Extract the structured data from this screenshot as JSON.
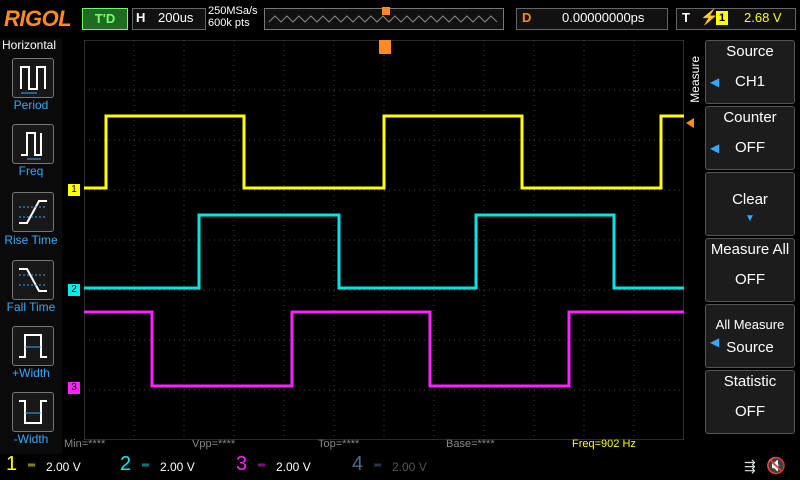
{
  "brand": "RIGOL",
  "trigger_status": "T'D",
  "timebase": {
    "label": "H",
    "value": "200us"
  },
  "sample_rate": "250MSa/s",
  "memory_depth": "600k pts",
  "delay": {
    "label": "D",
    "value": "0.00000000ps"
  },
  "trigger": {
    "label": "T",
    "edge": "rising-edge-icon",
    "source": "1",
    "level": "2.68 V"
  },
  "left_panel": {
    "title": "Horizontal",
    "items": [
      {
        "label": "Period",
        "icon": "period-icon"
      },
      {
        "label": "Freq",
        "icon": "freq-icon"
      },
      {
        "label": "Rise Time",
        "icon": "rise-time-icon"
      },
      {
        "label": "Fall Time",
        "icon": "fall-time-icon"
      },
      {
        "label": "+Width",
        "icon": "pos-width-icon"
      },
      {
        "label": "-Width",
        "icon": "neg-width-icon"
      }
    ]
  },
  "right_panel": {
    "title": "Measure",
    "items": [
      {
        "label": "Source",
        "value": "CH1"
      },
      {
        "label": "Counter",
        "value": "OFF"
      },
      {
        "label": "Clear",
        "value": ""
      },
      {
        "label": "Measure All",
        "value": "OFF"
      },
      {
        "label": "All Measure",
        "value": "Source"
      },
      {
        "label": "Statistic",
        "value": "OFF"
      }
    ]
  },
  "measurements": {
    "min": "Min=****",
    "vpp": "Vpp=****",
    "top": "Top=****",
    "base": "Base=****",
    "freq": "Freq=902 Hz"
  },
  "channels": [
    {
      "num": "1",
      "scale": "2.00 V",
      "color": "#ffff00"
    },
    {
      "num": "2",
      "scale": "2.00 V",
      "color": "#00e5e5"
    },
    {
      "num": "3",
      "scale": "2.00 V",
      "color": "#ff22ff"
    },
    {
      "num": "4",
      "scale": "2.00 V",
      "color": "#4a6a8a"
    }
  ],
  "colors": {
    "accent": "#ff8a1e",
    "ch1": "#ffff00",
    "ch2": "#00e5e5",
    "ch3": "#ff22ff"
  }
}
